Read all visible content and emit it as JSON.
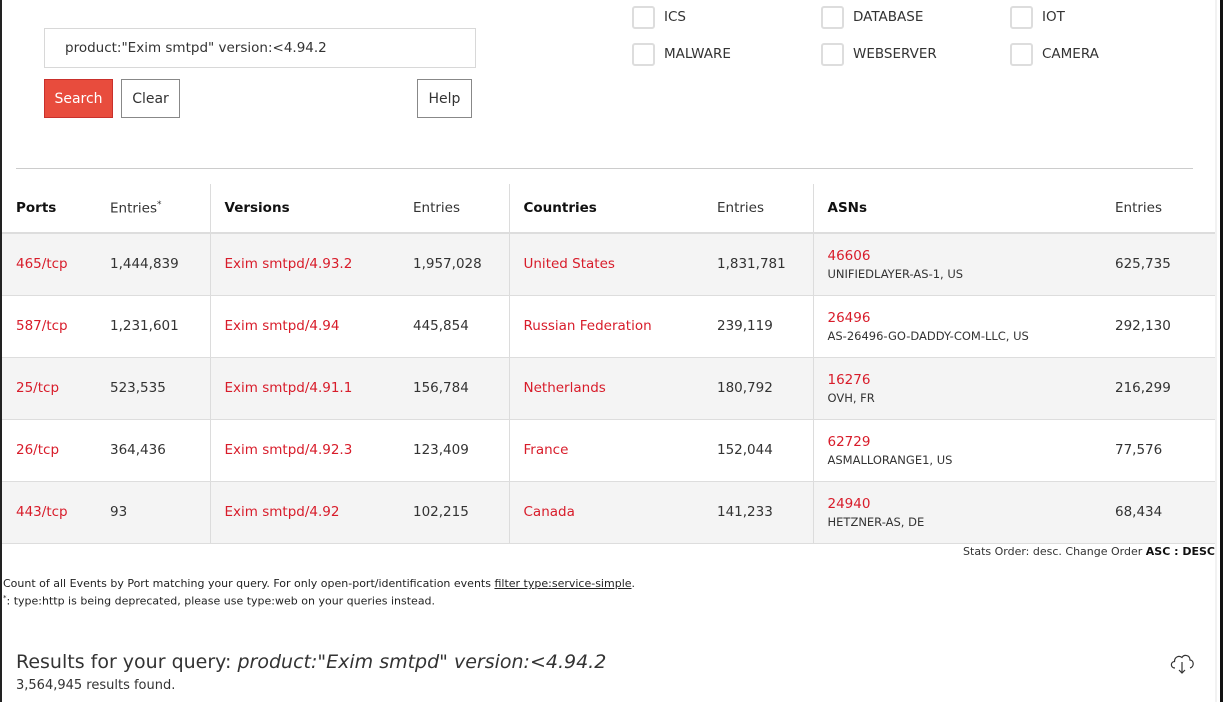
{
  "search": {
    "query": "product:\"Exim smtpd\" version:<4.94.2",
    "search_label": "Search",
    "clear_label": "Clear",
    "help_label": "Help"
  },
  "filters": [
    {
      "label": "ICS",
      "checked": false
    },
    {
      "label": "DATABASE",
      "checked": false
    },
    {
      "label": "IOT",
      "checked": false
    },
    {
      "label": "MALWARE",
      "checked": false
    },
    {
      "label": "WEBSERVER",
      "checked": false
    },
    {
      "label": "CAMERA",
      "checked": false
    }
  ],
  "stats": {
    "headers": {
      "ports": "Ports",
      "ports_entries": "Entries",
      "ports_entries_mark": "*",
      "versions": "Versions",
      "versions_entries": "Entries",
      "countries": "Countries",
      "countries_entries": "Entries",
      "asns": "ASNs",
      "asns_entries": "Entries"
    },
    "rows": [
      {
        "port": "465/tcp",
        "port_entries": "1,444,839",
        "version": "Exim smtpd/4.93.2",
        "version_entries": "1,957,028",
        "country": "United States",
        "country_entries": "1,831,781",
        "asn": "46606",
        "asn_name": "UNIFIEDLAYER-AS-1, US",
        "asn_entries": "625,735"
      },
      {
        "port": "587/tcp",
        "port_entries": "1,231,601",
        "version": "Exim smtpd/4.94",
        "version_entries": "445,854",
        "country": "Russian Federation",
        "country_entries": "239,119",
        "asn": "26496",
        "asn_name": "AS-26496-GO-DADDY-COM-LLC, US",
        "asn_entries": "292,130"
      },
      {
        "port": "25/tcp",
        "port_entries": "523,535",
        "version": "Exim smtpd/4.91.1",
        "version_entries": "156,784",
        "country": "Netherlands",
        "country_entries": "180,792",
        "asn": "16276",
        "asn_name": "OVH, FR",
        "asn_entries": "216,299"
      },
      {
        "port": "26/tcp",
        "port_entries": "364,436",
        "version": "Exim smtpd/4.92.3",
        "version_entries": "123,409",
        "country": "France",
        "country_entries": "152,044",
        "asn": "62729",
        "asn_name": "ASMALLORANGE1, US",
        "asn_entries": "77,576"
      },
      {
        "port": "443/tcp",
        "port_entries": "93",
        "version": "Exim smtpd/4.92",
        "version_entries": "102,215",
        "country": "Canada",
        "country_entries": "141,233",
        "asn": "24940",
        "asn_name": "HETZNER-AS, DE",
        "asn_entries": "68,434"
      }
    ],
    "order": {
      "prefix": "Stats Order: desc. Change Order ",
      "asc": "ASC",
      "divider": " : ",
      "desc": "DESC"
    }
  },
  "notes": {
    "count_text": "Count of all Events by Port matching your query. For only open-port/identification events ",
    "count_link": "filter type:service-simple",
    "count_end": ".",
    "deprecation_star": "*",
    "deprecation_text": ": type:http is being deprecated, please use type:web on your queries instead."
  },
  "results": {
    "title_prefix": "Results for your query: ",
    "title_query": "product:\"Exim smtpd\" version:<4.94.2",
    "count": "3,564,945 results found.",
    "download_icon": "cloud-download-icon"
  },
  "colors": {
    "accent": "#e84c3d",
    "link": "#d81c2a",
    "row_alt": "#f4f4f4"
  }
}
